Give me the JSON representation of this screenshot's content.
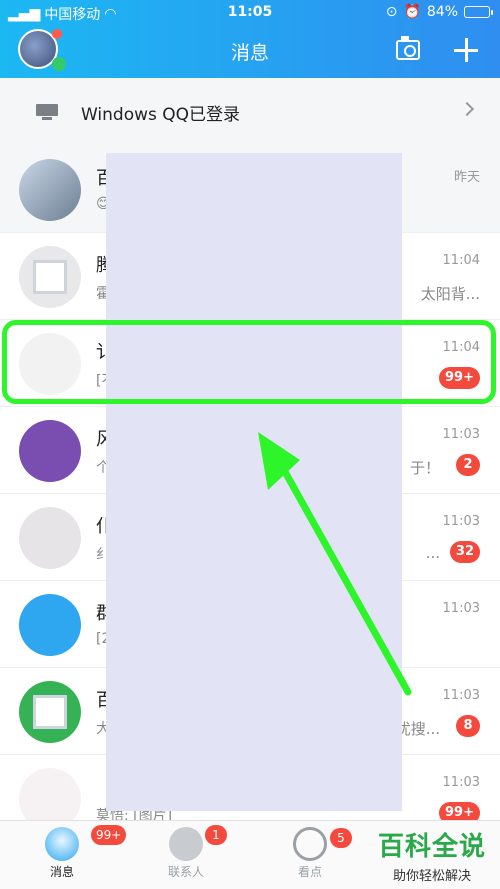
{
  "status_bar": {
    "carrier": "中国移动",
    "time": "11:05",
    "battery": "84%",
    "battery_level": 0.84
  },
  "header": {
    "title": "消息"
  },
  "banner": {
    "label": "Windows QQ已登录"
  },
  "chats": [
    {
      "name": "百",
      "preview": "😊",
      "time": "昨天",
      "tail": "",
      "badge": ""
    },
    {
      "name": "腾",
      "preview": "霍",
      "time": "11:04",
      "tail": "太阳背...",
      "badge": ""
    },
    {
      "name": "讠",
      "preview": "[不",
      "time": "11:04",
      "tail": "",
      "badge": "99+"
    },
    {
      "name": "风",
      "preview": "个",
      "time": "11:03",
      "tail": "于！",
      "badge": "2"
    },
    {
      "name": "仆",
      "preview": "纟",
      "time": "11:03",
      "tail": "...",
      "badge": "32"
    },
    {
      "name": "群",
      "preview": "[2",
      "time": "11:03",
      "tail": "",
      "badge": ""
    },
    {
      "name": "百",
      "preview": "大",
      "time": "11:03",
      "tail": "忧搜...",
      "badge": "8"
    },
    {
      "name": "",
      "preview": "莫悟: [图片]",
      "time": "11:03",
      "tail": "",
      "badge": "99+"
    }
  ],
  "tabs": {
    "messages": {
      "label": "消息",
      "badge": "99+"
    },
    "contacts": {
      "label": "联系人",
      "badge": "1"
    },
    "feed": {
      "label": "看点",
      "badge": "5"
    }
  },
  "watermark": {
    "main": "百科全说",
    "sub": "助你轻松解决"
  }
}
